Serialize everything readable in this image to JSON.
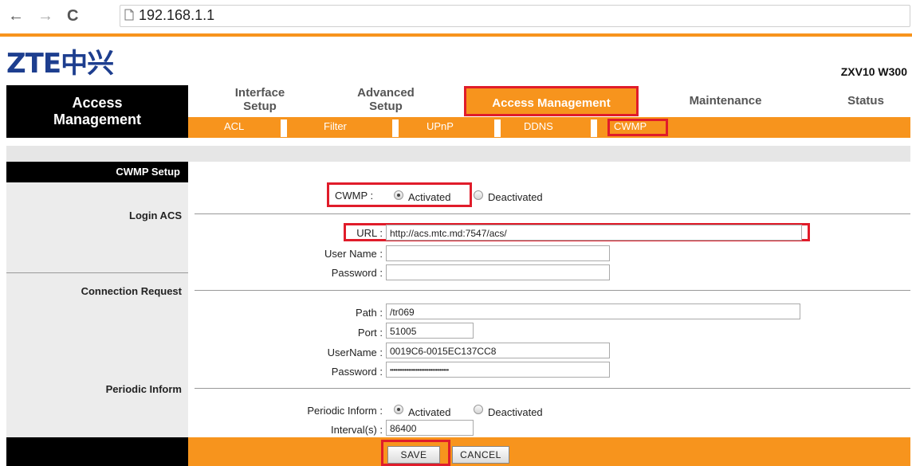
{
  "browser": {
    "url": "192.168.1.1"
  },
  "header": {
    "logo": "ZTE中兴",
    "model": "ZXV10 W300"
  },
  "left_title": "Access\nManagement",
  "tabs": [
    {
      "label": "Interface\nSetup"
    },
    {
      "label": "Advanced\nSetup"
    },
    {
      "label": "Access Management",
      "active": true
    },
    {
      "label": "Maintenance"
    },
    {
      "label": "Status"
    }
  ],
  "subtabs": [
    {
      "label": "ACL"
    },
    {
      "label": "Filter"
    },
    {
      "label": "UPnP"
    },
    {
      "label": "DDNS"
    },
    {
      "label": "CWMP",
      "active": true
    }
  ],
  "sections": {
    "cwmp_setup": "CWMP Setup",
    "login_acs": "Login ACS",
    "connection_request": "Connection Request",
    "periodic_inform": "Periodic Inform"
  },
  "cwmp": {
    "label": "CWMP :",
    "activated": "Activated",
    "deactivated": "Deactivated",
    "selected": "Activated"
  },
  "login_acs": {
    "url_label": "URL :",
    "url_value": "http://acs.mtc.md:7547/acs/",
    "username_label": "User Name :",
    "username_value": "",
    "password_label": "Password :",
    "password_value": ""
  },
  "connection_request": {
    "path_label": "Path :",
    "path_value": "/tr069",
    "port_label": "Port :",
    "port_value": "51005",
    "username_label": "UserName :",
    "username_value": "0019C6-0015EC137CC8",
    "password_label": "Password :",
    "password_value": "••••••••••••••••••••••••••••••••"
  },
  "periodic": {
    "label": "Periodic Inform :",
    "activated": "Activated",
    "deactivated": "Deactivated",
    "selected": "Activated",
    "interval_label": "Interval(s) :",
    "interval_value": "86400"
  },
  "buttons": {
    "save": "SAVE",
    "cancel": "CANCEL"
  },
  "colors": {
    "orange": "#f7941d",
    "highlight_red": "#e01c2a",
    "logo_blue": "#1d3e8f"
  }
}
